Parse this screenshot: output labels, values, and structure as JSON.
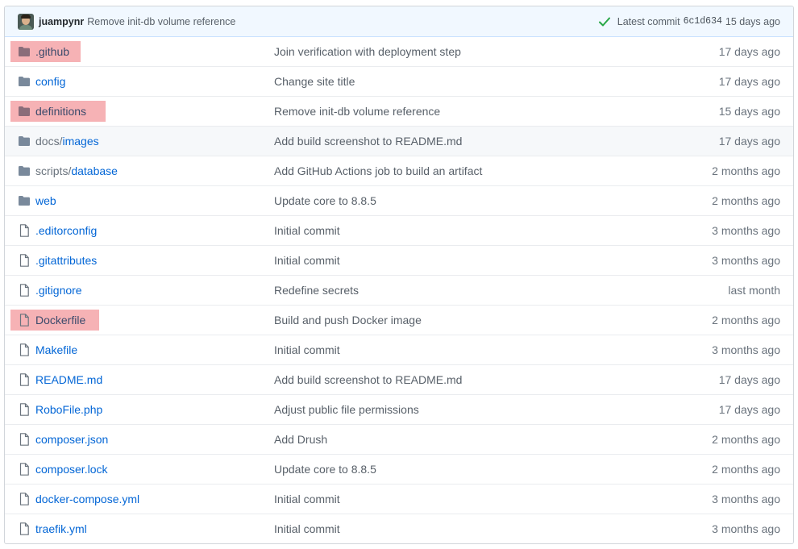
{
  "commit": {
    "author": "juampynr",
    "message": "Remove init-db volume reference",
    "latest_label": "Latest commit",
    "sha": "6c1d634",
    "age": "15 days ago",
    "status_color": "#28a745"
  },
  "files": [
    {
      "type": "dir",
      "prefix": "",
      "name": ".github",
      "message": "Join verification with deployment step",
      "age": "17 days ago",
      "highlighted": true
    },
    {
      "type": "dir",
      "prefix": "",
      "name": "config",
      "message": "Change site title",
      "age": "17 days ago",
      "highlighted": false
    },
    {
      "type": "dir",
      "prefix": "",
      "name": "definitions",
      "message": "Remove init-db volume reference",
      "age": "15 days ago",
      "highlighted": true
    },
    {
      "type": "dir",
      "prefix": "docs/",
      "name": "images",
      "message": "Add build screenshot to README.md",
      "age": "17 days ago",
      "highlighted": false,
      "hover": true
    },
    {
      "type": "dir",
      "prefix": "scripts/",
      "name": "database",
      "message": "Add GitHub Actions job to build an artifact",
      "age": "2 months ago",
      "highlighted": false
    },
    {
      "type": "dir",
      "prefix": "",
      "name": "web",
      "message": "Update core to 8.8.5",
      "age": "2 months ago",
      "highlighted": false
    },
    {
      "type": "file",
      "prefix": "",
      "name": ".editorconfig",
      "message": "Initial commit",
      "age": "3 months ago",
      "highlighted": false
    },
    {
      "type": "file",
      "prefix": "",
      "name": ".gitattributes",
      "message": "Initial commit",
      "age": "3 months ago",
      "highlighted": false
    },
    {
      "type": "file",
      "prefix": "",
      "name": ".gitignore",
      "message": "Redefine secrets",
      "age": "last month",
      "highlighted": false
    },
    {
      "type": "file",
      "prefix": "",
      "name": "Dockerfile",
      "message": "Build and push Docker image",
      "age": "2 months ago",
      "highlighted": true
    },
    {
      "type": "file",
      "prefix": "",
      "name": "Makefile",
      "message": "Initial commit",
      "age": "3 months ago",
      "highlighted": false
    },
    {
      "type": "file",
      "prefix": "",
      "name": "README.md",
      "message": "Add build screenshot to README.md",
      "age": "17 days ago",
      "highlighted": false
    },
    {
      "type": "file",
      "prefix": "",
      "name": "RoboFile.php",
      "message": "Adjust public file permissions",
      "age": "17 days ago",
      "highlighted": false
    },
    {
      "type": "file",
      "prefix": "",
      "name": "composer.json",
      "message": "Add Drush",
      "age": "2 months ago",
      "highlighted": false
    },
    {
      "type": "file",
      "prefix": "",
      "name": "composer.lock",
      "message": "Update core to 8.8.5",
      "age": "2 months ago",
      "highlighted": false
    },
    {
      "type": "file",
      "prefix": "",
      "name": "docker-compose.yml",
      "message": "Initial commit",
      "age": "3 months ago",
      "highlighted": false
    },
    {
      "type": "file",
      "prefix": "",
      "name": "traefik.yml",
      "message": "Initial commit",
      "age": "3 months ago",
      "highlighted": false
    }
  ],
  "colors": {
    "link": "#0366d6",
    "folder_icon": "#79b8ff",
    "file_icon": "#6a737d",
    "highlight": "#f5a5a8"
  }
}
